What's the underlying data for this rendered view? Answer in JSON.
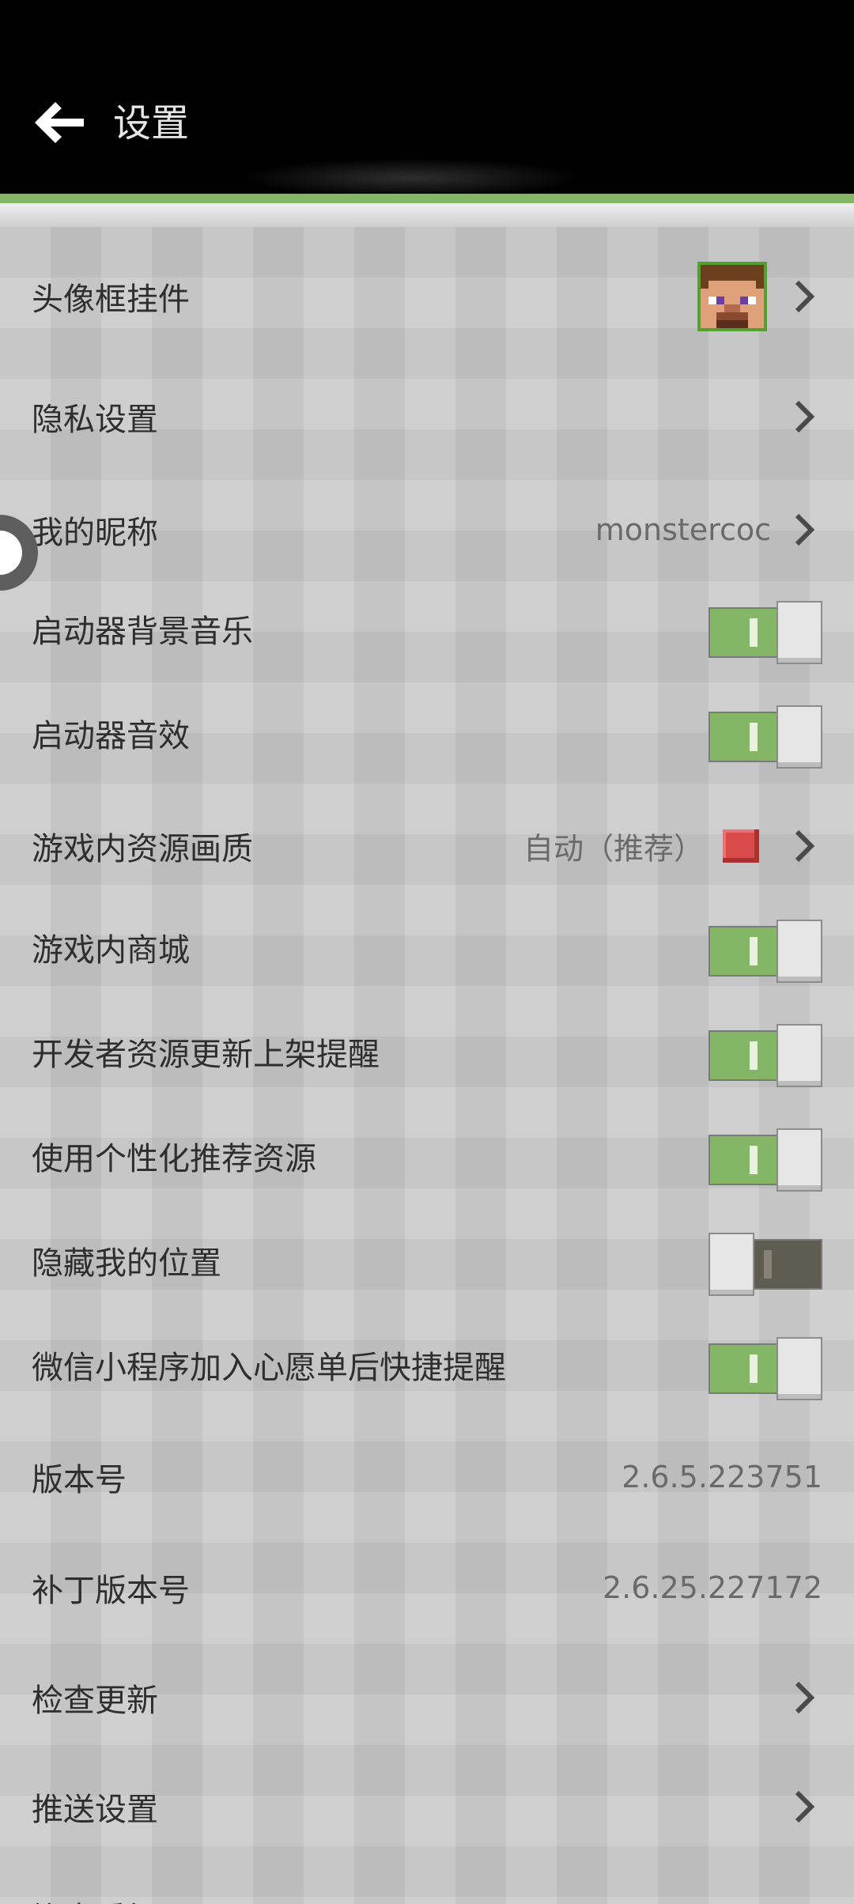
{
  "header": {
    "title": "设置"
  },
  "settings": {
    "avatar_frame": {
      "label": "头像框挂件"
    },
    "privacy": {
      "label": "隐私设置"
    },
    "nickname": {
      "label": "我的昵称",
      "value": "monstercoc"
    },
    "bg_music": {
      "label": "启动器背景音乐",
      "on": true
    },
    "sound_fx": {
      "label": "启动器音效",
      "on": true
    },
    "quality": {
      "label": "游戏内资源画质",
      "value": "自动（推荐）",
      "swatch_color": "#d94a4a"
    },
    "store": {
      "label": "游戏内商城",
      "on": true
    },
    "dev_reminder": {
      "label": "开发者资源更新上架提醒",
      "on": true
    },
    "personalized": {
      "label": "使用个性化推荐资源",
      "on": true
    },
    "hide_location": {
      "label": "隐藏我的位置",
      "on": false
    },
    "wechat_reminder": {
      "label": "微信小程序加入心愿单后快捷提醒",
      "on": true
    },
    "version": {
      "label": "版本号",
      "value": "2.6.5.223751"
    },
    "patch_version": {
      "label": "补丁版本号",
      "value": "2.6.25.227172"
    },
    "check_update": {
      "label": "检查更新"
    },
    "push_settings": {
      "label": "推送设置"
    },
    "next_item": {
      "label": "锻查看加是"
    }
  },
  "colors": {
    "accent_green": "#84b765",
    "toggle_off": "#5f5d52"
  }
}
